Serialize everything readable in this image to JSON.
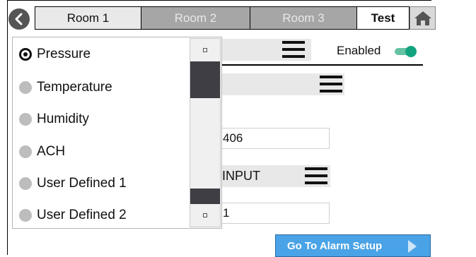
{
  "tabs": [
    {
      "label": "Room 1",
      "state": "active"
    },
    {
      "label": "Room 2",
      "state": "inactive"
    },
    {
      "label": "Room 3",
      "state": "inactive"
    },
    {
      "label": "Test",
      "state": "normal"
    }
  ],
  "icons": {
    "back": "back-arrow-icon",
    "home": "home-icon",
    "menu": "hamburger-menu-icon"
  },
  "form": {
    "enabled_label": "Enabled",
    "enabled_on": true,
    "field1_value": "406",
    "input_label": "INPUT",
    "field2_value": "1",
    "alarm_button": "Go To Alarm Setup"
  },
  "dropdown": {
    "options": [
      "Pressure",
      "Temperature",
      "Humidity",
      "ACH",
      "User Defined 1",
      "User Defined 2"
    ],
    "selected": "Pressure"
  },
  "colors": {
    "accent_blue": "#4aa3e6",
    "toggle_green": "#14a37f",
    "tab_inactive": "#a6a6a6"
  }
}
